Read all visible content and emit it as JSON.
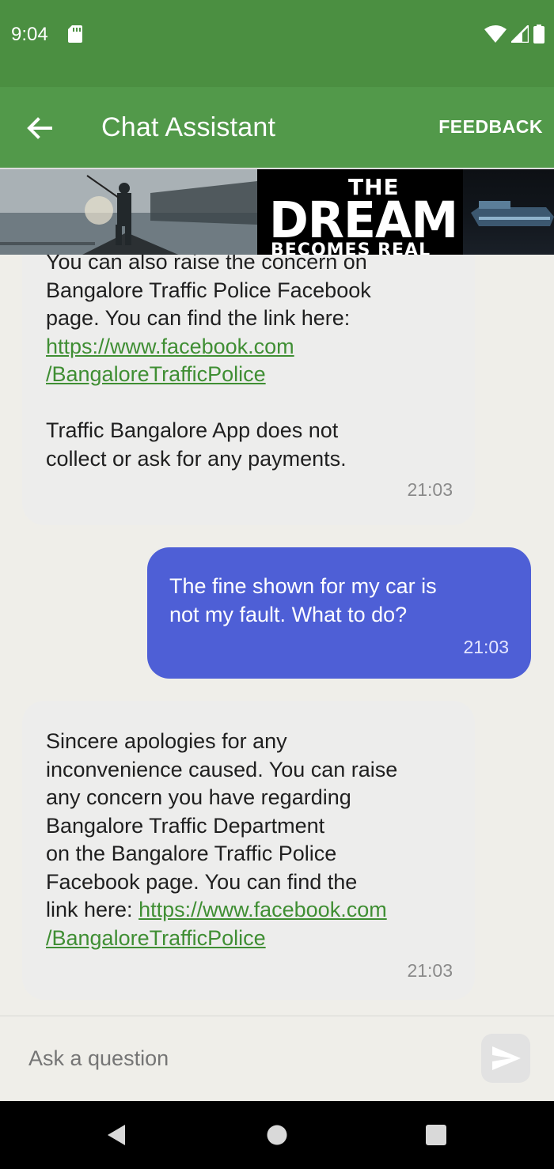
{
  "status_bar": {
    "time": "9:04",
    "icons": [
      "sd-card-icon",
      "wifi-icon",
      "signal-icon",
      "battery-icon"
    ]
  },
  "app_bar": {
    "title": "Chat Assistant",
    "feedback_label": "FEEDBACK",
    "back_icon": "arrow-left-icon",
    "color": "#52994a"
  },
  "banner": {
    "line1": "THE",
    "line2": "DREAM",
    "line3": "BECOMES REAL"
  },
  "messages": [
    {
      "sender": "bot",
      "text_before_link": "You can also raise the concern on\nBangalore Traffic Police Facebook\npage. You can find the link here:\n",
      "link": "https://www.facebook.com\n/BangaloreTrafficPolice",
      "text_after_link": "\n\nTraffic Bangalore App does not\ncollect or ask for any payments.",
      "time": "21:03"
    },
    {
      "sender": "user",
      "text": "The fine shown for my car is\nnot my fault. What to do?",
      "time": "21:03"
    },
    {
      "sender": "bot",
      "text_before_link": "Sincere apologies for any\ninconvenience caused. You can raise\nany concern you have regarding\nBangalore Traffic Department\non the Bangalore Traffic Police\nFacebook page. You can find the\nlink here: ",
      "link": "https://www.facebook.com\n/BangaloreTrafficPolice",
      "time": "21:03"
    }
  ],
  "input": {
    "placeholder": "Ask a question",
    "send_icon": "send-icon"
  },
  "nav": {
    "icons": [
      "back-triangle-icon",
      "home-circle-icon",
      "recents-square-icon"
    ]
  },
  "colors": {
    "status_bar": "#4b8f41",
    "user_bubble": "#4e5fd6",
    "bot_bubble": "#ededec",
    "link": "#3f8e33",
    "background": "#efeee9"
  }
}
